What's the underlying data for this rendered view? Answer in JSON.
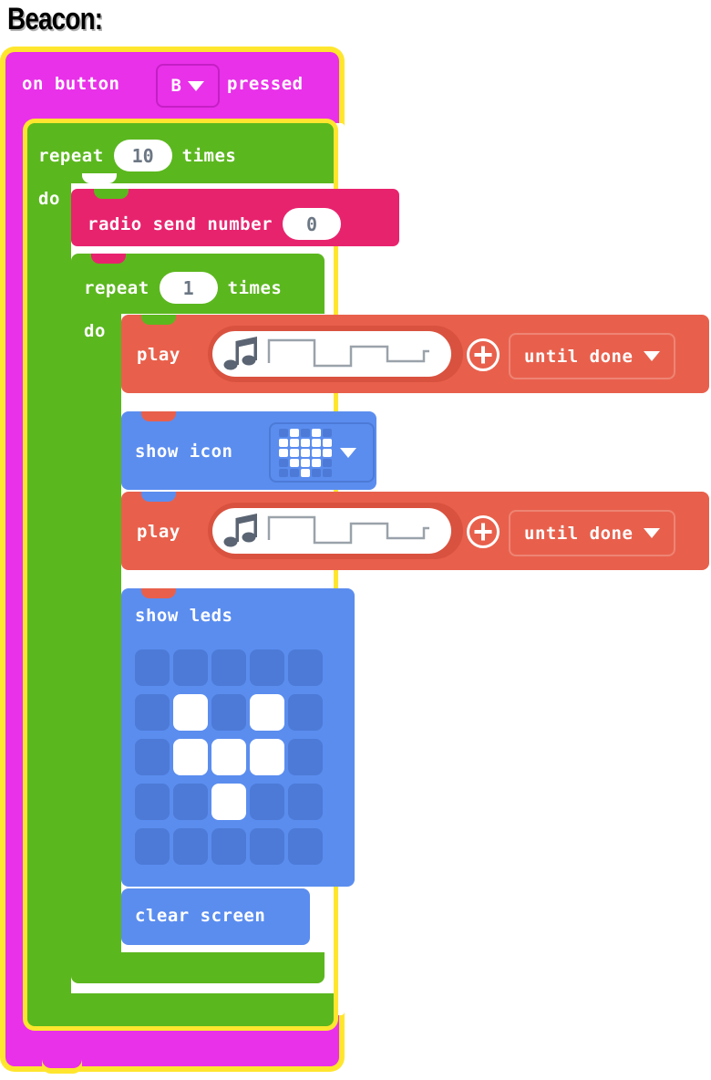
{
  "page": {
    "title": "Beacon:",
    "editor": "makecode-microbit-blocks"
  },
  "colors": {
    "event_block": "#E931E9",
    "selection_outline": "#FFE62E",
    "loop_block": "#5BB71E",
    "radio_block": "#E8236E",
    "music_block": "#E8604C",
    "led_block": "#5B8DEF",
    "field_white": "#FFFFFF",
    "field_text": "#6C7784",
    "led_off": "#4C7AD6"
  },
  "blocks": {
    "event": {
      "name": "on-button-pressed",
      "text_before": "on button",
      "text_after": "pressed",
      "button_value": "B",
      "dropdown_icon": "chevron-down-icon",
      "selected": true
    },
    "repeat_outer": {
      "name": "repeat-times-loop",
      "text_before": "repeat",
      "text_after": "times",
      "count": "10",
      "do_label": "do"
    },
    "radio_send": {
      "name": "radio-send-number",
      "label": "radio send number",
      "value": "0"
    },
    "repeat_inner": {
      "name": "repeat-times-loop",
      "text_before": "repeat",
      "text_after": "times",
      "count": "1",
      "do_label": "do"
    },
    "play_1": {
      "name": "music-play-melody",
      "label": "play",
      "melody_icon": "music-note-icon",
      "melody_waveform": "square-step-wave",
      "add_icon": "plus-circle-icon",
      "mode": "until done",
      "dropdown_icon": "chevron-down-icon"
    },
    "show_icon": {
      "name": "show-icon",
      "label": "show icon",
      "icon_name": "heart-icon",
      "dropdown_icon": "chevron-down-icon",
      "pattern": [
        [
          0,
          1,
          0,
          1,
          0
        ],
        [
          1,
          1,
          1,
          1,
          1
        ],
        [
          1,
          1,
          1,
          1,
          1
        ],
        [
          0,
          1,
          1,
          1,
          0
        ],
        [
          0,
          0,
          1,
          0,
          0
        ]
      ]
    },
    "play_2": {
      "name": "music-play-melody",
      "label": "play",
      "melody_icon": "music-note-icon",
      "melody_waveform": "square-step-wave",
      "add_icon": "plus-circle-icon",
      "mode": "until done",
      "dropdown_icon": "chevron-down-icon"
    },
    "show_leds": {
      "name": "show-leds",
      "label": "show leds",
      "pattern": [
        [
          0,
          0,
          0,
          0,
          0
        ],
        [
          0,
          1,
          0,
          1,
          0
        ],
        [
          0,
          1,
          1,
          1,
          0
        ],
        [
          0,
          0,
          1,
          0,
          0
        ],
        [
          0,
          0,
          0,
          0,
          0
        ]
      ]
    },
    "clear_screen": {
      "name": "clear-screen",
      "label": "clear screen"
    }
  }
}
